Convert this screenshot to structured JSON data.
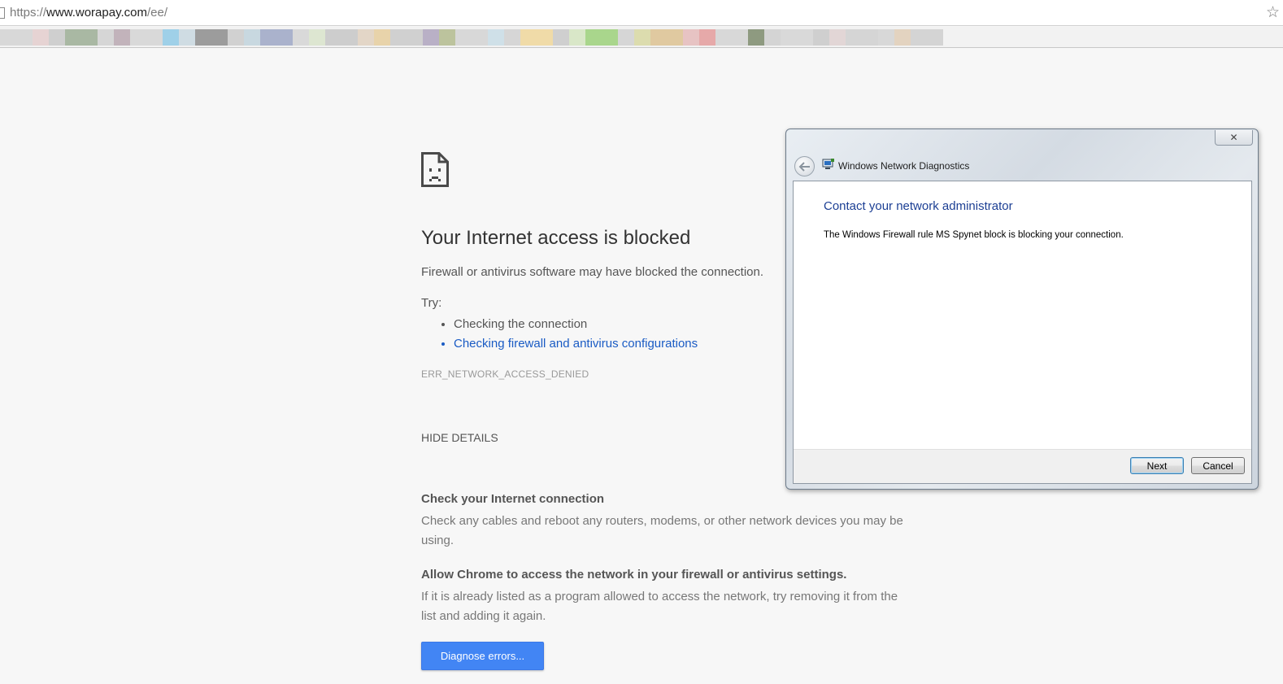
{
  "browser": {
    "url_scheme": "https://",
    "url_host": "www.worapay.com",
    "url_path": "/ee/",
    "star_icon": "☆"
  },
  "bookmark_colors": [
    "#d8d8d8",
    "#e6d3d3",
    "#cfcfcf",
    "#a9b8a3",
    "#d6d6d6",
    "#c2b3bb",
    "#d9d9d9",
    "#9fd0e8",
    "#cfdce3",
    "#9c9c9c",
    "#d1d1d1",
    "#c8d8e0",
    "#aab2cc",
    "#d9d9d9",
    "#dde6d1",
    "#cdcdcd",
    "#e3d6c7",
    "#e8d3aa",
    "#d0d0d0",
    "#b9b0c6",
    "#bcc39d",
    "#d8d8d8",
    "#cfe0e8",
    "#d6d6d6",
    "#f0dba8",
    "#cfcfcf",
    "#d9e7c8",
    "#a9d68c",
    "#d6d6d6",
    "#dcdcae",
    "#e0c9a0",
    "#e7c3c3",
    "#e6a9a9",
    "#d8d8d8",
    "#8e9a80",
    "#d4d4d4",
    "#d9d9d9",
    "#cfcfcf",
    "#e2d6d6",
    "#d5d5d5",
    "#d8d8d8",
    "#e3d3c0",
    "#d4d4d4"
  ],
  "error": {
    "title": "Your Internet access is blocked",
    "description": "Firewall or antivirus software may have blocked the connection.",
    "try_label": "Try:",
    "suggestions": [
      "Checking the connection",
      "Checking firewall and antivirus configurations"
    ],
    "code": "ERR_NETWORK_ACCESS_DENIED",
    "hide_details": "HIDE DETAILS",
    "details": [
      {
        "heading": "Check your Internet connection",
        "body": "Check any cables and reboot any routers, modems, or other network devices you may be using."
      },
      {
        "heading": "Allow Chrome to access the network in your firewall or antivirus settings.",
        "body": "If it is already listed as a program allowed to access the network, try removing it from the list and adding it again."
      }
    ],
    "diagnose_button": "Diagnose errors...",
    "link_color": "#1a5bc4",
    "button_color": "#4285f4"
  },
  "dialog": {
    "window_title": "Windows Network Diagnostics",
    "close_glyph": "✕",
    "heading": "Contact your network administrator",
    "message": "The Windows Firewall rule MS Spynet block is blocking your connection.",
    "next_button": "Next",
    "cancel_button": "Cancel",
    "heading_color": "#1c3f94"
  }
}
